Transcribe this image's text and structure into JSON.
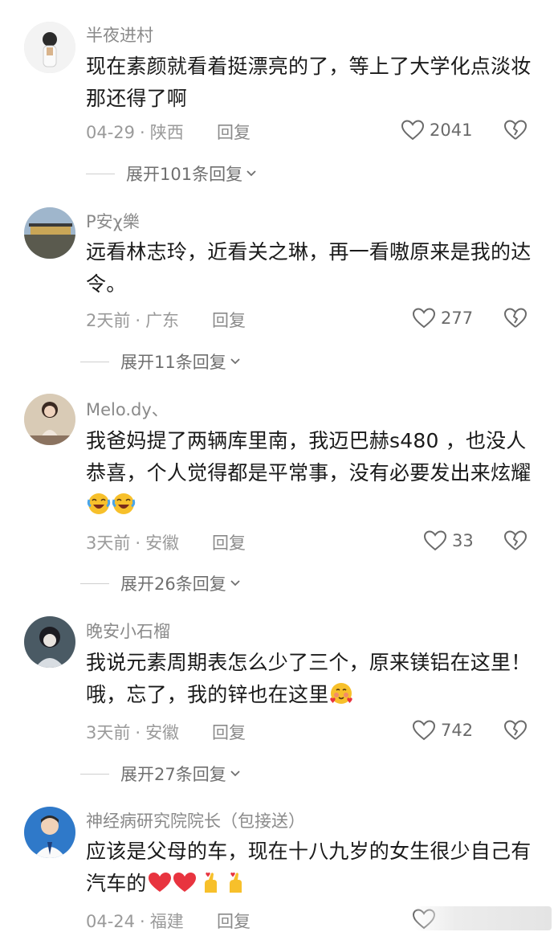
{
  "comments": [
    {
      "username": "半夜进村",
      "text": "现在素颜就看着挺漂亮的了，等上了大学化点淡妆那还得了啊",
      "time": "04-29",
      "location": "陕西",
      "reply_label": "回复",
      "likes": "2041",
      "expand_label": "展开101条回复"
    },
    {
      "username": "P安χ樂",
      "text": "远看林志玲，近看关之琳，再一看嗷原来是我的达令。",
      "time": "2天前",
      "location": "广东",
      "reply_label": "回复",
      "likes": "277",
      "expand_label": "展开11条回复"
    },
    {
      "username": "Melo.dy、",
      "text": "我爸妈提了两辆库里南，我迈巴赫s480 ，也没人恭喜，个人觉得都是平常事，没有必要发出来炫耀",
      "emojis": [
        "laughing-crying-emoji",
        "laughing-crying-emoji"
      ],
      "time": "3天前",
      "location": "安徽",
      "reply_label": "回复",
      "likes": "33",
      "expand_label": "展开26条回复"
    },
    {
      "username": "晚安小石榴",
      "text": "我说元素周期表怎么少了三个，原来镁铝在这里！哦，忘了，我的锌也在这里",
      "emojis": [
        "blushing-hearts-emoji"
      ],
      "time": "3天前",
      "location": "安徽",
      "reply_label": "回复",
      "likes": "742",
      "expand_label": "展开27条回复"
    },
    {
      "username": "神经病研究院院长（包接送）",
      "text": "应该是父母的车，现在十八九岁的女生很少自己有汽车的",
      "emojis": [
        "red-heart-emoji",
        "red-heart-emoji",
        "finger-heart-emoji",
        "finger-heart-emoji"
      ],
      "time": "04-24",
      "location": "福建",
      "reply_label": "回复",
      "likes": ""
    }
  ],
  "colors": {
    "username": "#8a8a8a",
    "body_text": "#1a1a1a",
    "meta": "#9a9a9a",
    "heart_red": "#e8343f",
    "emoji_yellow": "#f7c02b"
  }
}
